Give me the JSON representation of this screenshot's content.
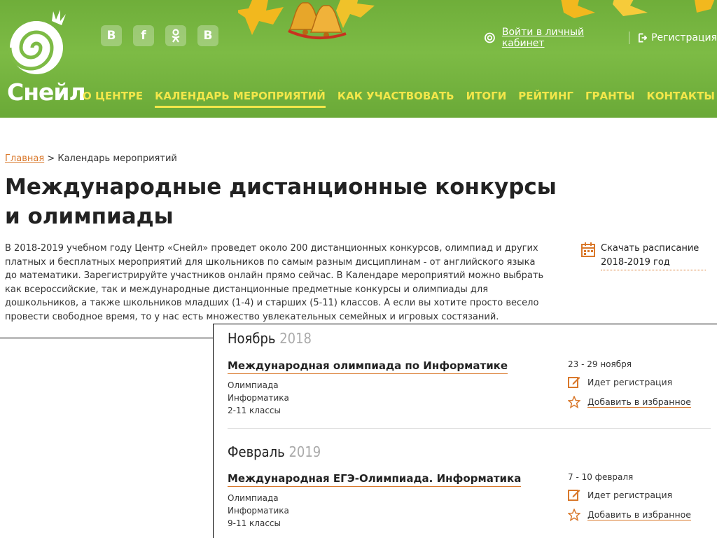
{
  "brand": {
    "name": "Снейл"
  },
  "social": [
    {
      "icon": "vk-icon",
      "glyph": "B"
    },
    {
      "icon": "facebook-icon",
      "glyph": "f"
    },
    {
      "icon": "odnoklassniki-icon",
      "glyph": "ok"
    },
    {
      "icon": "blog-icon",
      "glyph": "B"
    }
  ],
  "account": {
    "login_label": "Войти в личный кабинет",
    "register_label": "Регистрация"
  },
  "nav": [
    {
      "label": "О ЦЕНТРЕ",
      "active": false
    },
    {
      "label": "КАЛЕНДАРЬ МЕРОПРИЯТИЙ",
      "active": true
    },
    {
      "label": "КАК УЧАСТВОВАТЬ",
      "active": false
    },
    {
      "label": "ИТОГИ",
      "active": false
    },
    {
      "label": "РЕЙТИНГ",
      "active": false
    },
    {
      "label": "ГРАНТЫ",
      "active": false
    },
    {
      "label": "КОНТАКТЫ",
      "active": false
    }
  ],
  "breadcrumb": {
    "home": "Главная",
    "separator": ">",
    "current": "Календарь мероприятий"
  },
  "page": {
    "title": "Международные дистанционные конкурсы и олимпиады",
    "intro": "В 2018-2019 учебном году Центр «Снейл» проведет около 200 дистанционных конкурсов, олимпиад и других платных и бесплатных мероприятий для школьников по самым разным дисциплинам - от английского языка до математики. Зарегистрируйте участников онлайн прямо сейчас. В Календаре мероприятий можно выбрать как всероссийские, так и международные дистанционные предметные конкурсы и олимпиады для дошкольников, а также школьников младших (1-4) и старших (5-11) классов. А если вы хотите просто весело провести свободное время, то у нас есть множество увлекательных семейных и игровых состязаний.",
    "download_label": "Скачать расписание 2018-2019 год"
  },
  "months": [
    {
      "month": "Ноябрь",
      "year": "2018",
      "event": {
        "title": "Международная олимпиада по Информатике",
        "type": "Олимпиада",
        "subject": "Информатика",
        "grades": "2-11 классы",
        "dates": "23 - 29 ноября",
        "registration": "Идет регистрация",
        "favorite": "Добавить в избранное"
      }
    },
    {
      "month": "Февраль",
      "year": "2019",
      "event": {
        "title": "Международная ЕГЭ-Олимпиада. Информатика",
        "type": "Олимпиада",
        "subject": "Информатика",
        "grades": "9-11 классы",
        "dates": "7 - 10 февраля",
        "registration": "Идет регистрация",
        "favorite": "Добавить в избранное"
      }
    }
  ],
  "colors": {
    "header_green": "#7dbb45",
    "nav_yellow": "#f3e74a",
    "link_orange": "#d9782b"
  }
}
